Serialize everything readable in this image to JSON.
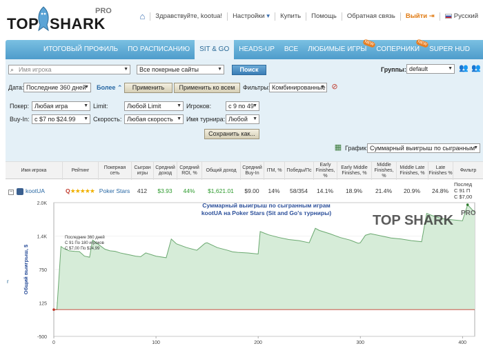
{
  "header": {
    "logo_top": "TOP",
    "logo_shark": "SHARK",
    "logo_pro": "PRO",
    "greeting": "Здравствуйте, kootua!",
    "settings": "Настройки",
    "buy": "Купить",
    "help": "Помощь",
    "feedback": "Обратная связь",
    "logout": "Выйти",
    "language": "Русский"
  },
  "tabs": [
    {
      "label": "Итоговый профиль",
      "active": false,
      "new": false
    },
    {
      "label": "По расписанию",
      "active": false,
      "new": false
    },
    {
      "label": "Sit & Go",
      "active": true,
      "new": false
    },
    {
      "label": "Heads-Up",
      "active": false,
      "new": false
    },
    {
      "label": "Все",
      "active": false,
      "new": false
    },
    {
      "label": "Любимые игры",
      "active": false,
      "new": true
    },
    {
      "label": "Соперники",
      "active": false,
      "new": true
    },
    {
      "label": "Super HUD",
      "active": false,
      "new": false
    }
  ],
  "new_badge": "new",
  "filters": {
    "player_placeholder": "Имя игрока",
    "sites": "Все покерные сайты",
    "search_btn": "Поиск",
    "groups_label": "Группы:",
    "groups_value": "default",
    "date_label": "Дата:",
    "date_value": "Последние 360 дней",
    "more_link": "Более",
    "apply_btn": "Применить",
    "apply_all_btn": "Применить ко всем",
    "filters_label": "Фильтры:",
    "filters_value": "Комбинированные",
    "poker_label": "Покер:",
    "poker_value": "Любая игра",
    "limit_label": "Limit:",
    "limit_value": "Любой Limit",
    "players_label": "Игроков:",
    "players_value": "с 9 по 49",
    "buyin_label": "Buy-In:",
    "buyin_value": "с $7 по $24.99",
    "speed_label": "Скорость:",
    "speed_value": "Любая скорость",
    "tourname_label": "Имя турнира:",
    "tourname_value": "Любой",
    "save_btn": "Сохранить как...",
    "graph_label": "График:",
    "graph_value": "Суммарный выигрыш по сыгранным"
  },
  "table": {
    "headers": [
      "Имя игрока",
      "Рейтинг",
      "Покерная сеть",
      "Сыгран игры",
      "Средний доход",
      "Средний ROI, %",
      "Общий доход",
      "Средний Buy-In",
      "ITM, %",
      "Победы/Пс",
      "Early Finishes, %",
      "Early Middle Finishes, %",
      "Middle Finishes, %",
      "Middle Late Finishes, %",
      "Late Finishes %",
      "Фильтр"
    ],
    "row": {
      "expander": "−",
      "name": "kootUA",
      "rating_badge": "Q",
      "rating_stars": "★★★★★",
      "network": "Poker Stars",
      "games": "412",
      "avg_profit": "$3.93",
      "avg_roi": "44%",
      "total_profit": "$1,621.01",
      "avg_buyin": "$9.00",
      "itm": "14%",
      "wins": "58/354",
      "early": "14.1%",
      "early_middle": "18.9%",
      "middle": "21.4%",
      "middle_late": "20.9%",
      "late": "24.8%",
      "filter_1": "Послед",
      "filter_2": "С 91 П",
      "filter_3": "С $7,00"
    }
  },
  "chart_data": {
    "type": "area",
    "title": "Суммарный выигрыш по сыгранным играм",
    "subtitle": "kootUA на Poker Stars (Sit and Go's турниры)",
    "ylabel": "Общий выигрыш, $",
    "xlabel": "",
    "ylim": [
      -500,
      2000
    ],
    "xlim": [
      0,
      412
    ],
    "yticks": [
      "-500",
      "125",
      "750",
      "1.4K",
      "2.0K"
    ],
    "ytick_values": [
      -500,
      125,
      750,
      1375,
      2000
    ],
    "xticks": [
      "0",
      "100",
      "200",
      "300",
      "400"
    ],
    "xtick_values": [
      0,
      100,
      200,
      300,
      400
    ],
    "annotation": [
      "Последние 360 дней",
      "С 91 По 180 игроков",
      "С $7,00 По $24,99"
    ],
    "fill_color": "#d6ecd8",
    "line_color": "#6aa86f",
    "zero_line_color": "#c0392b",
    "series": [
      {
        "x": [
          0,
          3,
          7,
          10,
          15,
          20,
          25,
          30,
          35,
          38,
          45,
          50,
          55,
          60,
          65,
          70,
          75,
          80,
          85,
          90,
          100,
          110,
          115,
          120,
          130,
          140,
          148,
          150,
          160,
          170,
          175,
          180,
          190,
          200,
          202,
          210,
          220,
          230,
          240,
          250,
          256,
          260,
          270,
          280,
          290,
          298,
          300,
          305,
          310,
          320,
          330,
          340,
          350,
          360,
          365,
          370,
          380,
          390,
          400,
          405,
          412
        ],
        "y": [
          0,
          0,
          1180,
          1140,
          1100,
          1090,
          1085,
          1000,
          980,
          1300,
          1200,
          1130,
          1100,
          1090,
          1060,
          1040,
          1020,
          1000,
          990,
          1060,
          1000,
          970,
          1320,
          1230,
          1160,
          1110,
          1240,
          1250,
          1160,
          1110,
          1080,
          1070,
          1060,
          1040,
          1460,
          1400,
          1350,
          1310,
          1290,
          1250,
          1520,
          1480,
          1420,
          1350,
          1300,
          1240,
          1250,
          1390,
          1420,
          1380,
          1340,
          1320,
          1290,
          1270,
          1800,
          1760,
          1700,
          1680,
          1660,
          1960,
          1820
        ]
      }
    ]
  }
}
